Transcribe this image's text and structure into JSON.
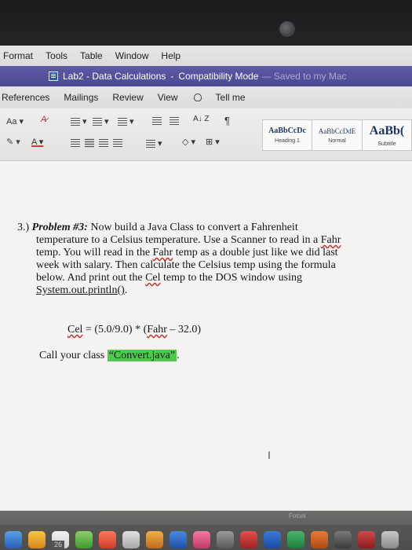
{
  "menubar": {
    "items": [
      "Format",
      "Tools",
      "Table",
      "Window",
      "Help"
    ]
  },
  "titlebar": {
    "doc_title": "Lab2 - Data Calculations",
    "separator": "-",
    "mode": "Compatibility Mode",
    "saved": "— Saved to my Mac"
  },
  "ribbon_tabs": [
    "References",
    "Mailings",
    "Review",
    "View"
  ],
  "tell_me": "Tell me",
  "ribbon": {
    "font_size_label": "Aa",
    "font_color_label": "A",
    "pilcrow": "¶",
    "sort_label": "A↓ Z"
  },
  "styles": [
    {
      "sample": "AaBbCcDc",
      "name": "Heading 1"
    },
    {
      "sample": "AaBbCcDdE",
      "name": "Normal"
    },
    {
      "sample": "AaBb(",
      "name": "Subtitle"
    }
  ],
  "document": {
    "number": "3.)",
    "problem_label": "Problem #3:",
    "line1_rest": " Now build a Java Class to convert a Fahrenheit",
    "line2": "temperature to a Celsius temperature.  Use a Scanner to read in a ",
    "fahr1": "Fahr",
    "line3_pre": "temp.  You will read in the ",
    "fahr2": "Fahr",
    "line3_post": " temp as a double just like we did last",
    "line4": "week with salary.  Then calculate the Celsius temp using the formula",
    "line5_pre": "below.  And print out the ",
    "cel1": "Cel",
    "line5_post": " temp to the DOS window using",
    "println": "System.out.println()",
    "line6_post": ".",
    "formula_cel": "Cel",
    "formula_mid": " = (5.0/9.0) * (",
    "formula_fahr": "Fahr",
    "formula_end": " – 32.0)",
    "call_pre": "Call your class ",
    "class_name": "“Convert.java”",
    "call_post": "."
  },
  "cursor_glyph": "I",
  "dock": {
    "focus_label": "Focus",
    "date": "26"
  }
}
